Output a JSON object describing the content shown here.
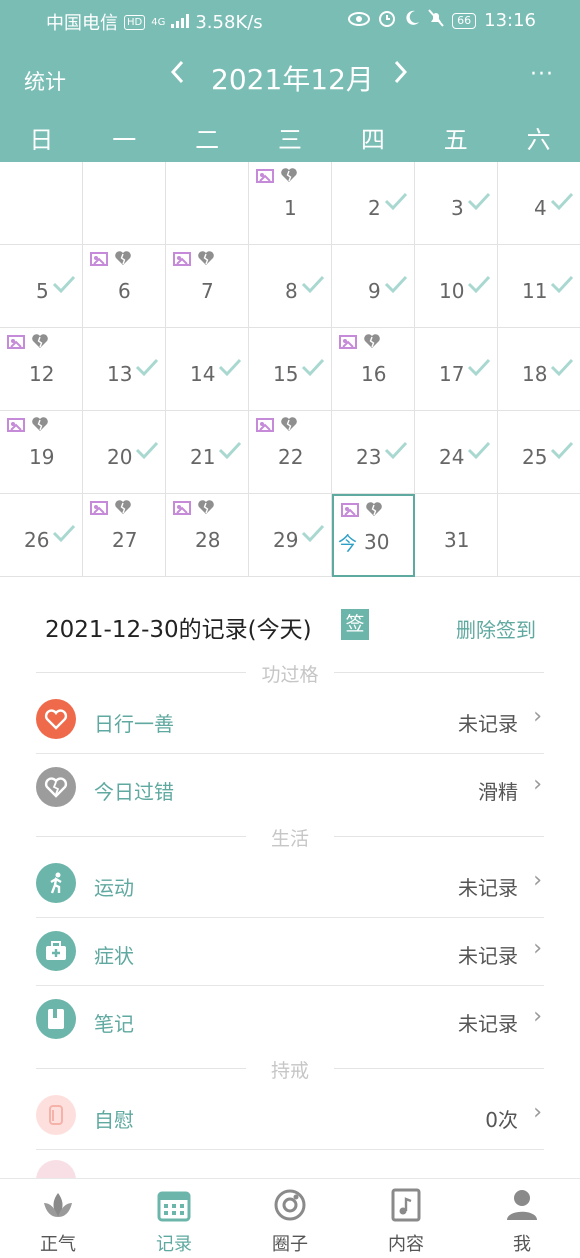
{
  "status_bar": {
    "carrier": "中国电信",
    "hd": "HD",
    "network": "4G",
    "speed": "3.58K/s",
    "battery": "66",
    "time": "13:16"
  },
  "header": {
    "stats_label": "统计",
    "prev_icon": "chevron-left-icon",
    "month_title": "2021年12月",
    "next_icon": "chevron-right-icon",
    "more_icon": "more-icon",
    "more_label": "···"
  },
  "weekdays": [
    "日",
    "一",
    "二",
    "三",
    "四",
    "五",
    "六"
  ],
  "calendar": {
    "check_icon": "check-icon",
    "today_tag": "今",
    "days": [
      {
        "day": "1",
        "col": 3,
        "row": 0,
        "check": false,
        "icons": true
      },
      {
        "day": "2",
        "col": 4,
        "row": 0,
        "check": true,
        "icons": false
      },
      {
        "day": "3",
        "col": 5,
        "row": 0,
        "check": true,
        "icons": false
      },
      {
        "day": "4",
        "col": 6,
        "row": 0,
        "check": true,
        "icons": false
      },
      {
        "day": "5",
        "col": 0,
        "row": 1,
        "check": true,
        "icons": false
      },
      {
        "day": "6",
        "col": 1,
        "row": 1,
        "check": false,
        "icons": true
      },
      {
        "day": "7",
        "col": 2,
        "row": 1,
        "check": false,
        "icons": true
      },
      {
        "day": "8",
        "col": 3,
        "row": 1,
        "check": true,
        "icons": false
      },
      {
        "day": "9",
        "col": 4,
        "row": 1,
        "check": true,
        "icons": false
      },
      {
        "day": "10",
        "col": 5,
        "row": 1,
        "check": true,
        "icons": false
      },
      {
        "day": "11",
        "col": 6,
        "row": 1,
        "check": true,
        "icons": false
      },
      {
        "day": "12",
        "col": 0,
        "row": 2,
        "check": false,
        "icons": true
      },
      {
        "day": "13",
        "col": 1,
        "row": 2,
        "check": true,
        "icons": false
      },
      {
        "day": "14",
        "col": 2,
        "row": 2,
        "check": true,
        "icons": false
      },
      {
        "day": "15",
        "col": 3,
        "row": 2,
        "check": true,
        "icons": false
      },
      {
        "day": "16",
        "col": 4,
        "row": 2,
        "check": false,
        "icons": true
      },
      {
        "day": "17",
        "col": 5,
        "row": 2,
        "check": true,
        "icons": false
      },
      {
        "day": "18",
        "col": 6,
        "row": 2,
        "check": true,
        "icons": false
      },
      {
        "day": "19",
        "col": 0,
        "row": 3,
        "check": false,
        "icons": true
      },
      {
        "day": "20",
        "col": 1,
        "row": 3,
        "check": true,
        "icons": false
      },
      {
        "day": "21",
        "col": 2,
        "row": 3,
        "check": true,
        "icons": false
      },
      {
        "day": "22",
        "col": 3,
        "row": 3,
        "check": false,
        "icons": true
      },
      {
        "day": "23",
        "col": 4,
        "row": 3,
        "check": true,
        "icons": false
      },
      {
        "day": "24",
        "col": 5,
        "row": 3,
        "check": true,
        "icons": false
      },
      {
        "day": "25",
        "col": 6,
        "row": 3,
        "check": true,
        "icons": false
      },
      {
        "day": "26",
        "col": 0,
        "row": 4,
        "check": true,
        "icons": false
      },
      {
        "day": "27",
        "col": 1,
        "row": 4,
        "check": false,
        "icons": true
      },
      {
        "day": "28",
        "col": 2,
        "row": 4,
        "check": false,
        "icons": true
      },
      {
        "day": "29",
        "col": 3,
        "row": 4,
        "check": true,
        "icons": false
      },
      {
        "day": "30",
        "col": 4,
        "row": 4,
        "check": false,
        "icons": true,
        "today": true
      },
      {
        "day": "31",
        "col": 5,
        "row": 4,
        "check": false,
        "icons": false
      }
    ]
  },
  "record": {
    "title": "2021-12-30的记录(今天)",
    "sign_badge": "签",
    "delete_label": "删除签到"
  },
  "sections": {
    "merit": "功过格",
    "life": "生活",
    "precepts": "持戒"
  },
  "rows": [
    {
      "icon": "heart-icon",
      "label": "日行一善",
      "value": "未记录",
      "color": "#ef6a4a"
    },
    {
      "icon": "broken-heart-icon",
      "label": "今日过错",
      "value": "滑精",
      "color": "#9c9c9c"
    },
    {
      "icon": "running-icon",
      "label": "运动",
      "value": "未记录",
      "color": "#6cb5aa"
    },
    {
      "icon": "medical-kit-icon",
      "label": "症状",
      "value": "未记录",
      "color": "#6cb5aa"
    },
    {
      "icon": "notebook-icon",
      "label": "笔记",
      "value": "未记录",
      "color": "#6cb5aa"
    },
    {
      "icon": "tissue-icon",
      "label": "自慰",
      "value": "0次",
      "color": "#fde0dd"
    }
  ],
  "tabbar": [
    {
      "label": "正气",
      "icon": "lotus-icon"
    },
    {
      "label": "记录",
      "icon": "calendar-icon",
      "active": true
    },
    {
      "label": "圈子",
      "icon": "circle-icon"
    },
    {
      "label": "内容",
      "icon": "music-book-icon"
    },
    {
      "label": "我",
      "icon": "user-icon"
    }
  ]
}
